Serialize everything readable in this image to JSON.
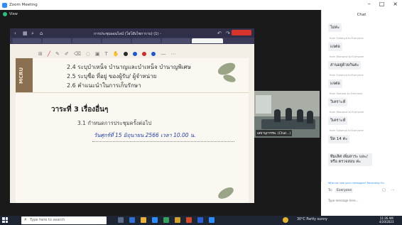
{
  "window": {
    "title": "Zoom Meeting",
    "minimize": "–",
    "maximize": "□",
    "close": "×"
  },
  "meeting": {
    "status_label": "View"
  },
  "browser": {
    "tab_title": "การประชุมออนไลน์ (โฮโอ๊บไซการาบ) (1) -"
  },
  "slide": {
    "band_text": "MCRU",
    "items": [
      "2.4 ระบุบำเหน็จ บำนาญและบำเหน็จ บำนาญพิเศษ",
      "2.5 ระบุชื่อ ที่อยู่ ของผู้รับ/ ผู้จำหน่าย",
      "2.6 คำแนะนำในการเก็บรักษา"
    ],
    "agenda3": "วาระที่ 3 เรื่องอื่นๆ",
    "sub31": "3.1 กำหนดการประชุมครั้งต่อไป",
    "handwritten": "วันศุกร์ที่ 15 มิถุนายน 2566 เวลา 10.00 น."
  },
  "video": {
    "participant_name": "เลขานุการรพ. (Chat...)"
  },
  "chat": {
    "title": "Chat",
    "messages": [
      {
        "sender": "",
        "text": "ไม่ค่ะ"
      },
      {
        "sender": "from Sukanya to Everyone",
        "text": "เเจต่อ"
      },
      {
        "sender": "from Worawut to Everyone",
        "text": "ส่านอยู่ด้วยกันค่ะ"
      },
      {
        "sender": "from Sukanya to Everyone",
        "text": "เเจต่อ"
      },
      {
        "sender": "from Somsak to Everyone",
        "text": "วิเคราะห์"
      },
      {
        "sender": "from Worawut to Everyone",
        "text": "วิเคราะห์"
      },
      {
        "sender": "from Sukanya to Everyone",
        "text": "ปิด 14 ค่ะ"
      },
      {
        "sender": "",
        "text": "ทีมเลิศ เพิ่มสาระ และ/หรือ ตรวจสอบ ค่ะ"
      }
    ],
    "files_link": "Who can see your messages? Recording On",
    "to_label": "To:",
    "to_value": "Everyone",
    "input_placeholder": "Type message here..."
  },
  "taskbar": {
    "search_placeholder": "Type here to search",
    "weather": "30°C Partly sunny",
    "time": "11:26 AM",
    "date": "4/20/2023"
  },
  "colors": {
    "accent": "#2d8cff",
    "band": "#8a6f50",
    "handwriting": "#1e3fa8"
  }
}
